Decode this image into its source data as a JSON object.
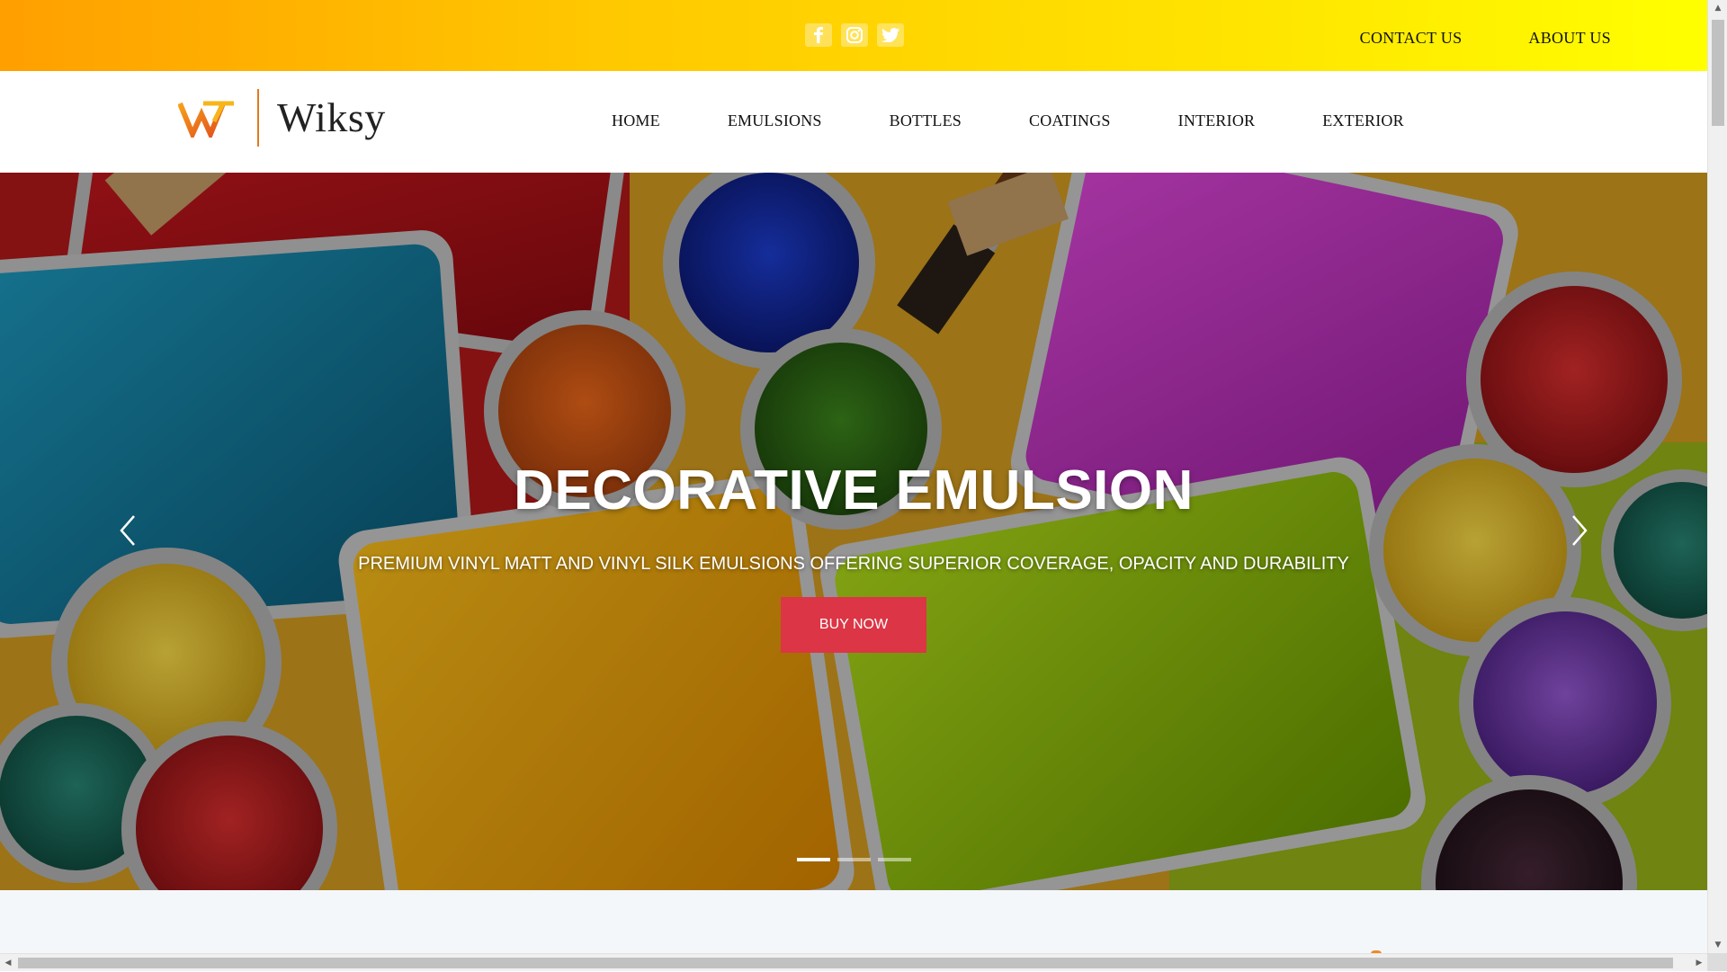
{
  "topbar": {
    "social": [
      {
        "name": "facebook-icon"
      },
      {
        "name": "instagram-icon"
      },
      {
        "name": "twitter-icon"
      }
    ],
    "links": [
      "CONTACT US",
      "ABOUT US"
    ]
  },
  "brand": {
    "name": "Wiksy",
    "accent": "#e07a1c"
  },
  "nav": {
    "items": [
      "HOME",
      "EMULSIONS",
      "BOTTLES",
      "COATINGS",
      "INTERIOR",
      "EXTERIOR"
    ]
  },
  "hero": {
    "title": "DECORATIVE EMULSION",
    "subtitle": "PREMIUM VINYL MATT AND VINYL SILK EMULSIONS OFFERING SUPERIOR COVERAGE, OPACITY AND DURABILITY",
    "button": "BUY NOW",
    "button_color": "#dc3545",
    "slide_count": 3,
    "active_slide": 1,
    "prev_icon": "chevron-left-icon",
    "next_icon": "chevron-right-icon"
  },
  "colors": {
    "topbar_start": "#ff9f00",
    "topbar_end": "#ffff00"
  }
}
